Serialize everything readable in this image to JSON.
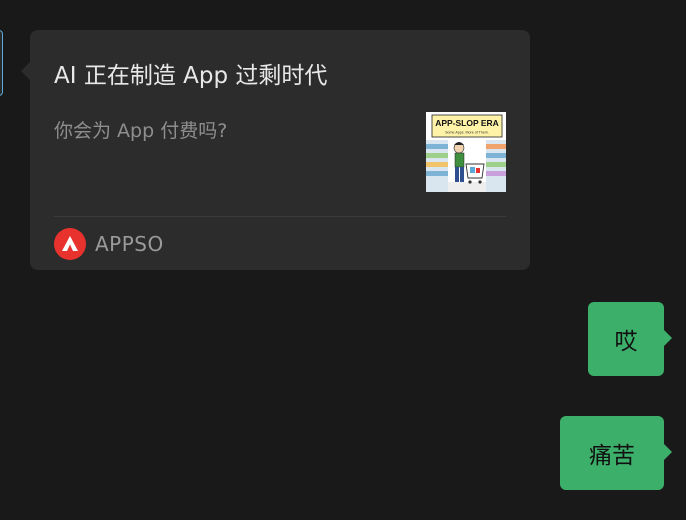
{
  "link_card": {
    "title": "AI 正在制造 App 过剩时代",
    "description": "你会为 App 付费吗?",
    "thumbnail": {
      "banner_text": "APP-SLOP ERA",
      "sub_text": "Some Apps. More of Them."
    },
    "source": {
      "name": "APPSO",
      "logo_color": "#e8322d"
    }
  },
  "messages": [
    {
      "text": "哎"
    },
    {
      "text": "痛苦"
    }
  ],
  "colors": {
    "background": "#191919",
    "card": "#2c2c2c",
    "sent_bubble": "#3cb06a"
  }
}
